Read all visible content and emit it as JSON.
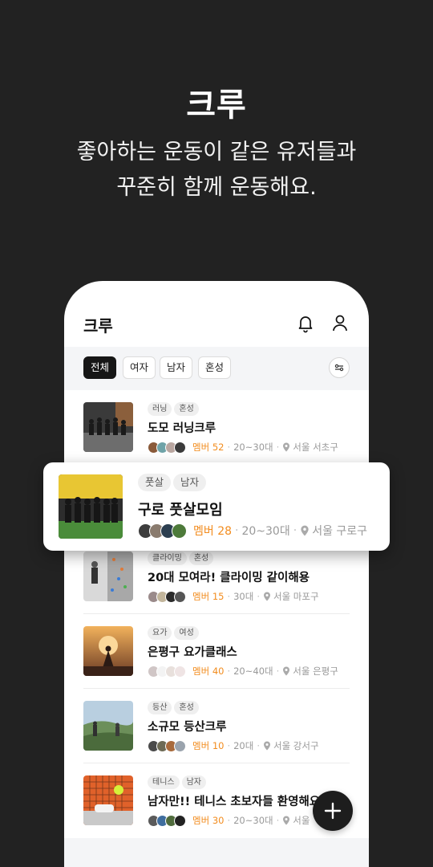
{
  "hero": {
    "title": "크루",
    "subtitle_line1": "좋아하는 운동이 같은 유저들과",
    "subtitle_line2": "꾸준히 함께 운동해요."
  },
  "app": {
    "title": "크루",
    "icons": [
      "bell-icon",
      "user-icon"
    ]
  },
  "filters": {
    "chips": [
      {
        "label": "전체",
        "active": true
      },
      {
        "label": "여자",
        "active": false
      },
      {
        "label": "남자",
        "active": false
      },
      {
        "label": "혼성",
        "active": false
      }
    ],
    "filter_icon": "sliders-icon"
  },
  "highlight": {
    "tags": [
      "풋살",
      "남자"
    ],
    "name": "구로 풋살모임",
    "members": "멤버 28",
    "age": "20~30대",
    "location": "서울 구로구"
  },
  "crews": [
    {
      "tags": [
        "러닝",
        "혼성"
      ],
      "name": "도모 러닝크루",
      "members": "멤버 52",
      "age": "20~30대",
      "location": "서울 서초구"
    },
    {
      "tags": [
        "클라이밍",
        "혼성"
      ],
      "name": "20대 모여라! 클라이밍 같이해용",
      "members": "멤버 15",
      "age": "30대",
      "location": "서울 마포구"
    },
    {
      "tags": [
        "요가",
        "여성"
      ],
      "name": "은평구 요가클래스",
      "members": "멤버 40",
      "age": "20~40대",
      "location": "서울 은평구"
    },
    {
      "tags": [
        "등산",
        "혼성"
      ],
      "name": "소규모 등산크루",
      "members": "멤버 10",
      "age": "20대",
      "location": "서울 강서구"
    },
    {
      "tags": [
        "테니스",
        "남자"
      ],
      "name": "남자만!! 테니스 초보자들 환영해요",
      "members": "멤버 30",
      "age": "20~30대",
      "location": "서울"
    }
  ],
  "fab": {
    "icon": "plus-icon"
  },
  "colors": {
    "background": "#222222",
    "accent": "#f28c1e",
    "chip_active": "#161616"
  }
}
